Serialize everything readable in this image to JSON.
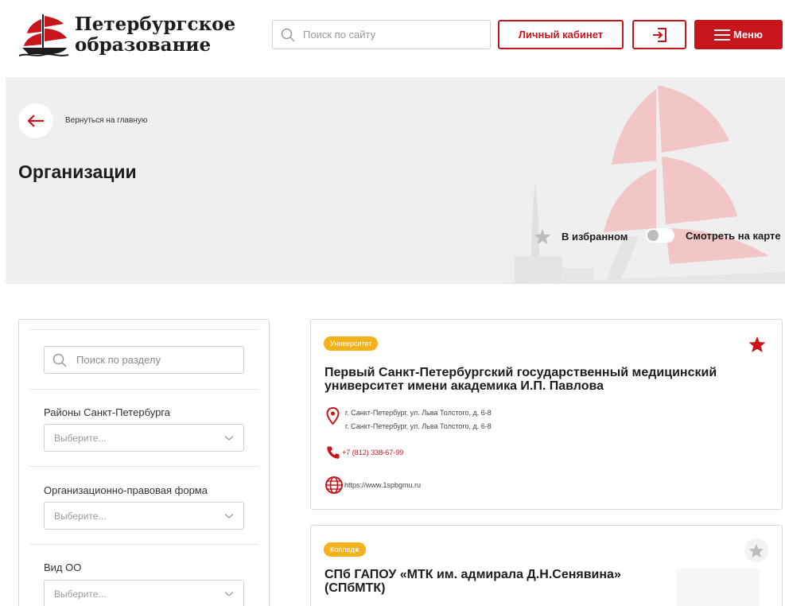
{
  "header": {
    "logo_line1": "Петербургское",
    "logo_line2": "образование",
    "search_placeholder": "Поиск по сайту",
    "cabinet_label": "Личный кабинет",
    "menu_label": "Меню",
    "accent_color": "#c8151b"
  },
  "hero": {
    "back_label": "Вернуться на главную",
    "title": "Организации",
    "favorites_label": "В избранном",
    "map_label": "Смотреть на карте",
    "map_toggle_on": false
  },
  "filters": {
    "search_placeholder": "Поиск по разделу",
    "groups": [
      {
        "label": "Районы Санкт-Петербурга",
        "value": "Выберите..."
      },
      {
        "label": "Организационно-правовая форма",
        "value": "Выберите..."
      },
      {
        "label": "Вид ОО",
        "value": "Выберите..."
      }
    ]
  },
  "cards": [
    {
      "badge": "Университет",
      "title": "Первый Санкт-Петербургский государственный медицинский университет имени академика И.П. Павлова",
      "address_lines": [
        "г. Санкт-Петербург, ул. Льва Толстого, д. 6-8",
        "г. Санкт-Петербург, ул. Льва Толстого, д. 6-8"
      ],
      "phone": "+7 (812) 338-67-99",
      "website": "https://www.1spbgmu.ru",
      "favorite": true,
      "icons": [
        "map-pin-icon",
        "phone-icon",
        "globe-icon",
        "star-icon"
      ]
    },
    {
      "badge": "Колледж",
      "title": "СПб ГАПОУ «МТК им. адмирала Д.Н.Сенявина» (СПбМТК)",
      "favorite": false,
      "icons": [
        "star-icon"
      ]
    }
  ],
  "colors": {
    "badge": "#f2b21b",
    "hero_bg": "#efefef",
    "border": "#d9d9d9"
  }
}
